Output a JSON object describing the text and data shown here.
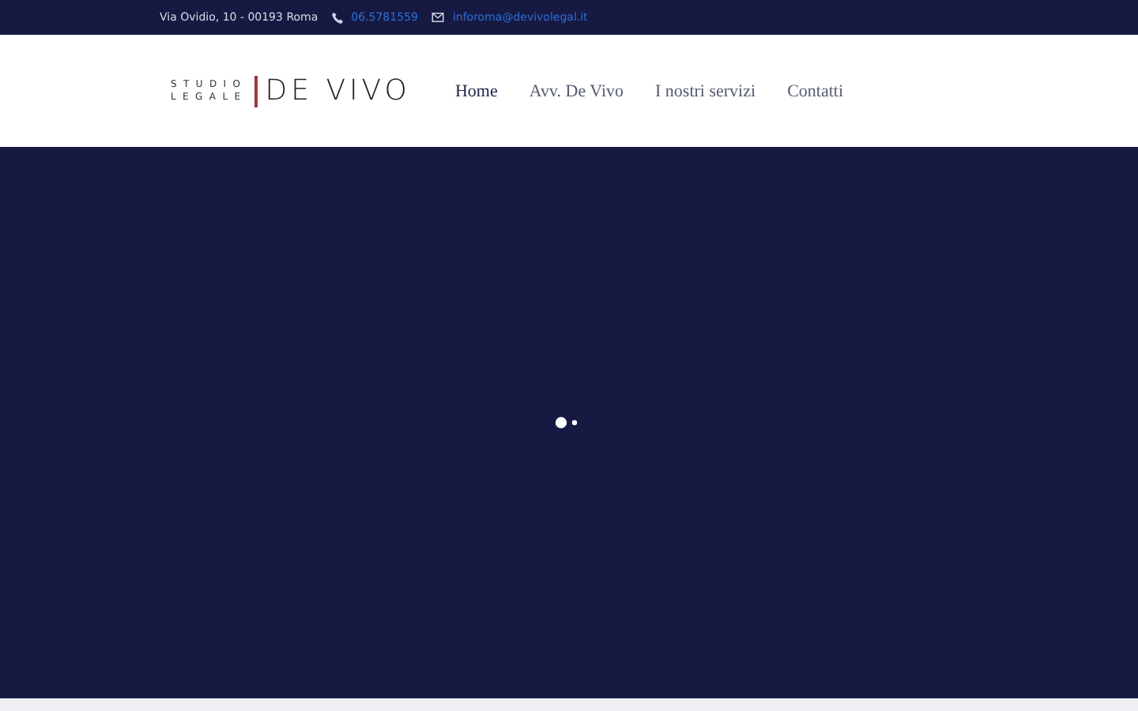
{
  "topbar": {
    "address": "Via Ovidio, 10 - 00193 Roma",
    "phone": "06.5781559",
    "email": "inforoma@devivolegal.it"
  },
  "logo": {
    "line_1": "STUDIO",
    "line_2": "LEGALE",
    "name": "DE VIVO"
  },
  "nav": [
    {
      "label": "Home",
      "selected": true
    },
    {
      "label": "Avv. De Vivo",
      "selected": false
    },
    {
      "label": "I nostri servizi",
      "selected": false
    },
    {
      "label": "Contatti",
      "selected": false
    }
  ]
}
